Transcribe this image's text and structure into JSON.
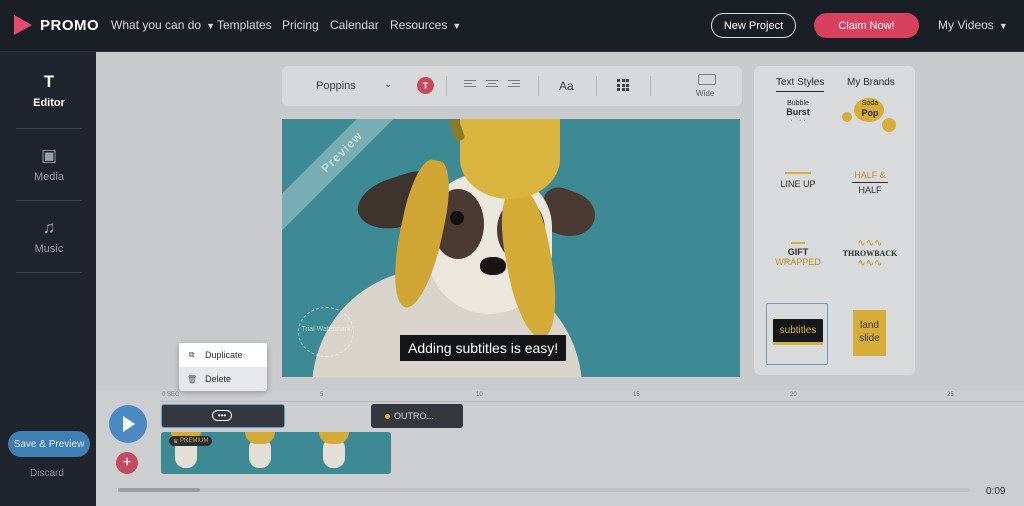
{
  "brand": {
    "name": "PROMO",
    "color": "#e64a6c"
  },
  "nav": {
    "items": [
      {
        "label": "What you can do",
        "has_chevron": true
      },
      {
        "label": "Templates",
        "has_chevron": false
      },
      {
        "label": "Pricing",
        "has_chevron": false
      },
      {
        "label": "Calendar",
        "has_chevron": false
      },
      {
        "label": "Resources",
        "has_chevron": true
      }
    ],
    "new_project": "New Project",
    "claim_now": "Claim Now!",
    "my_videos": "My Videos"
  },
  "sidebar": {
    "items": [
      {
        "label": "Editor",
        "icon": "text-icon"
      },
      {
        "label": "Media",
        "icon": "media-icon"
      },
      {
        "label": "Music",
        "icon": "music-icon"
      }
    ],
    "save_preview": "Save & Preview",
    "discard": "Discard"
  },
  "toolbar": {
    "font": "Poppins",
    "color_letter": "T",
    "text_size_label": "Aa",
    "wide_label": "Wide"
  },
  "canvas": {
    "ribbon": "Preview",
    "watermark": "Trial Watermark",
    "subtitle": "Adding subtitles is easy!"
  },
  "right_panel": {
    "tabs": [
      "Text Styles",
      "My Brands"
    ],
    "styles": {
      "bubble_1": "Bubble",
      "bubble_2": "Burst",
      "soda_1": "Soda",
      "soda_2": "Pop",
      "line_up": "LINE UP",
      "half_1": "HALF &",
      "half_2": "HALF",
      "gift_1": "GIFT",
      "gift_2": "WRAPPED",
      "throwback": "THROWBACK",
      "subtitles": "subtitles",
      "land_1": "land",
      "land_2": "slide"
    }
  },
  "timeline": {
    "ruler": [
      "0 SEC",
      "5",
      "10",
      "15",
      "20",
      "25"
    ],
    "outro": "OUTRO...",
    "premium": "PREMIUM",
    "duration": "0:09"
  },
  "context_menu": {
    "duplicate": "Duplicate",
    "delete": "Delete"
  }
}
